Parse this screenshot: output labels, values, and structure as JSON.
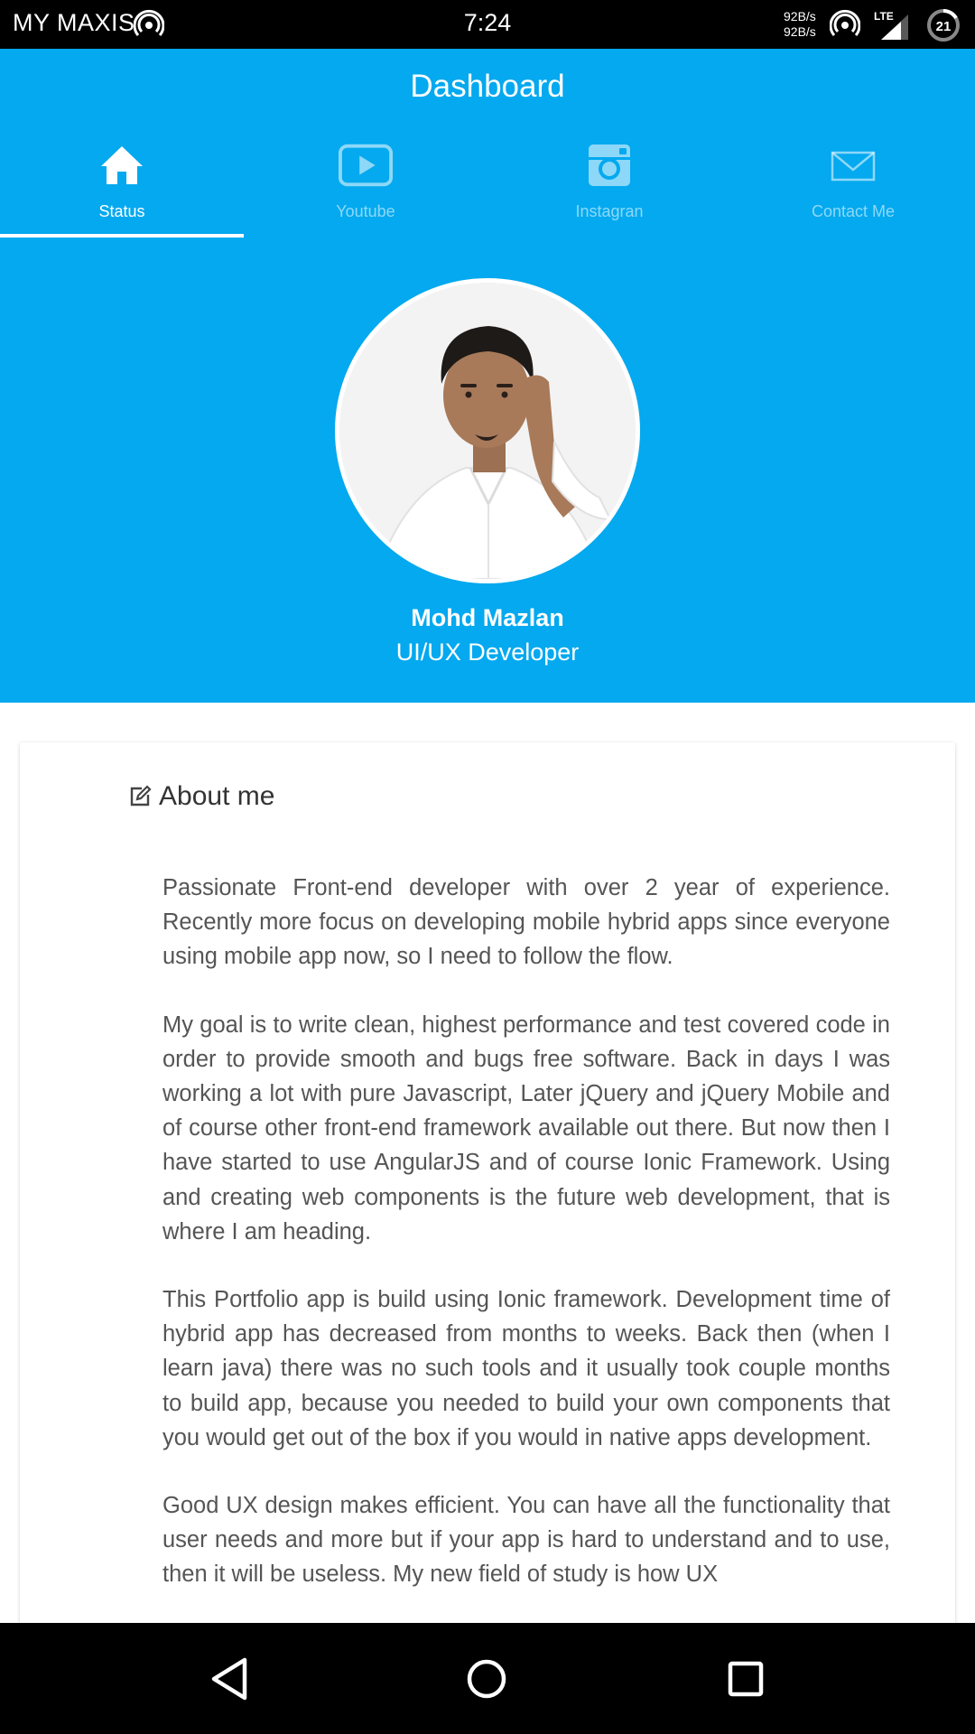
{
  "status_bar": {
    "carrier": "MY MAXIS",
    "time": "7:24",
    "speed_up": "92B/s",
    "speed_down": "92B/s",
    "network": "LTE",
    "battery": "21"
  },
  "header": {
    "title": "Dashboard",
    "background_color": "#04a9ef",
    "tabs": [
      {
        "label": "Status",
        "icon": "home-icon",
        "active": true
      },
      {
        "label": "Youtube",
        "icon": "youtube-icon",
        "active": false
      },
      {
        "label": "Instagran",
        "icon": "instagram-icon",
        "active": false
      },
      {
        "label": "Contact Me",
        "icon": "mail-icon",
        "active": false
      }
    ]
  },
  "profile": {
    "name": "Mohd Mazlan",
    "role": "UI/UX Developer"
  },
  "about": {
    "title": "About me",
    "icon": "edit-icon",
    "paragraphs": [
      "Passionate Front-end developer with over 2 year of experience. Recently more focus on developing mobile hybrid apps since everyone using mobile app now, so I need to follow the flow.",
      "My goal is to write clean, highest performance and test covered code in order to provide smooth and bugs free software. Back in days I was working a lot with pure Javascript, Later jQuery and jQuery Mobile and of course other front-end framework available out there. But now then I have started to use AngularJS and of course Ionic Framework. Using and creating web components is the future web development, that is where I am heading.",
      "This Portfolio app is build using Ionic framework. Development time of hybrid app has decreased from months to weeks. Back then (when I learn java) there was no such tools and it usually took couple months to build app, because you needed to build your own components that you would get out of the box if you would in native apps development.",
      "Good UX design makes efficient. You can have all the functionality that user needs and more but if your app is hard to understand and to use, then it will be useless. My new field of study is how UX"
    ]
  },
  "nav_bar": {
    "buttons": [
      "back-icon",
      "home-circle-icon",
      "recents-icon"
    ]
  }
}
